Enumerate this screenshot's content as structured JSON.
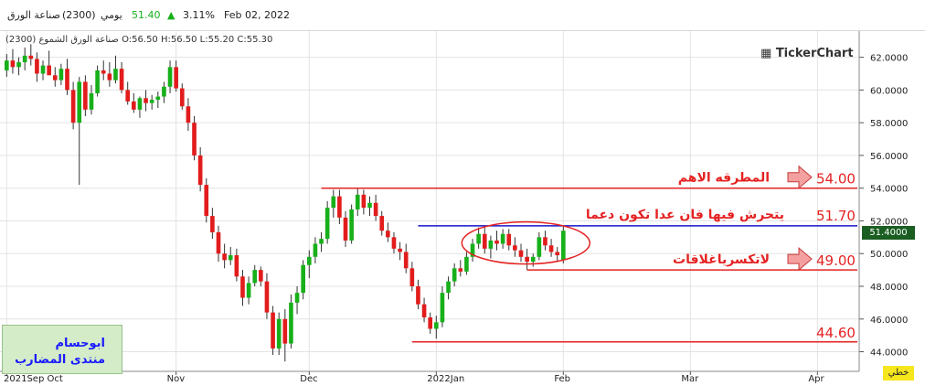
{
  "header": {
    "date": "Feb 02, 2022",
    "change_pct": "3.11%",
    "up_arrow": "▲",
    "price": "51.40",
    "period": "يومي",
    "symbol": "(2300)",
    "name": "صناعة الورق"
  },
  "subtitle": "صناعة الورق الشموع (2300) O:56.50 H:56.50 L:55.20 C:55.30",
  "logo": "TickerChart",
  "price_tag": "51.4000",
  "chart_mode": "خطي",
  "watermark": {
    "line1": "ابوحسام",
    "line2": "منتدى المضارب"
  },
  "colors": {
    "up": "#17b01a",
    "down": "#e21c1c",
    "level": "#e52222",
    "resistance_blue": "#1616c8",
    "grid": "#e3e3e3"
  },
  "chart_data": {
    "type": "candlestick",
    "ylim": [
      42.8,
      63.6
    ],
    "y_ticks": [
      {
        "value": 44,
        "label": "44.0000"
      },
      {
        "value": 46,
        "label": "46.0000"
      },
      {
        "value": 48,
        "label": "48.0000"
      },
      {
        "value": 50,
        "label": "50.0000"
      },
      {
        "value": 52,
        "label": "52.0000"
      },
      {
        "value": 54,
        "label": "54.0000"
      },
      {
        "value": 56,
        "label": "56.0000"
      },
      {
        "value": 58,
        "label": "58.0000"
      },
      {
        "value": 60,
        "label": "60.0000"
      },
      {
        "value": 62,
        "label": "62.0000"
      }
    ],
    "x_ticks": [
      {
        "index": 0,
        "label": "2021Sep Oct"
      },
      {
        "index": 28,
        "label": "Nov"
      },
      {
        "index": 50,
        "label": "Dec"
      },
      {
        "index": 71,
        "label": "2022Jan"
      },
      {
        "index": 92,
        "label": "Feb"
      },
      {
        "index": 113,
        "label": "Mar"
      },
      {
        "index": 134,
        "label": "Apr"
      }
    ],
    "x_slots": 142,
    "candles": [
      [
        61.2,
        62.2,
        60.8,
        61.8
      ],
      [
        61.8,
        62.5,
        61.0,
        61.4
      ],
      [
        61.4,
        62.0,
        60.9,
        61.7
      ],
      [
        61.7,
        62.6,
        61.2,
        62.1
      ],
      [
        62.1,
        62.8,
        61.5,
        61.9
      ],
      [
        61.9,
        62.3,
        60.5,
        61.0
      ],
      [
        61.0,
        61.8,
        60.6,
        61.5
      ],
      [
        61.5,
        62.4,
        61.0,
        60.9
      ],
      [
        60.9,
        61.4,
        60.2,
        60.6
      ],
      [
        60.6,
        61.6,
        60.3,
        61.3
      ],
      [
        61.3,
        61.9,
        59.7,
        60.0
      ],
      [
        60.0,
        60.5,
        57.6,
        58.0
      ],
      [
        58.0,
        60.8,
        54.2,
        60.5
      ],
      [
        60.5,
        60.9,
        58.4,
        58.8
      ],
      [
        58.8,
        60.3,
        58.5,
        59.8
      ],
      [
        59.8,
        61.5,
        59.6,
        61.2
      ],
      [
        61.2,
        61.8,
        60.6,
        61.0
      ],
      [
        61.0,
        61.7,
        60.2,
        60.6
      ],
      [
        60.6,
        62.1,
        60.4,
        61.3
      ],
      [
        61.3,
        61.7,
        59.8,
        60.0
      ],
      [
        60.0,
        60.5,
        59.1,
        59.3
      ],
      [
        59.3,
        59.8,
        58.6,
        58.8
      ],
      [
        58.8,
        59.6,
        58.3,
        59.5
      ],
      [
        59.5,
        60.0,
        58.7,
        59.2
      ],
      [
        59.2,
        59.7,
        58.8,
        59.4
      ],
      [
        59.4,
        59.9,
        58.9,
        59.6
      ],
      [
        59.6,
        60.5,
        59.2,
        60.2
      ],
      [
        60.2,
        61.8,
        59.8,
        61.4
      ],
      [
        61.4,
        61.8,
        59.9,
        60.1
      ],
      [
        60.1,
        60.4,
        58.8,
        59.0
      ],
      [
        59.0,
        59.5,
        57.5,
        58.0
      ],
      [
        58.0,
        58.4,
        55.7,
        56.0
      ],
      [
        56.0,
        56.5,
        53.8,
        54.2
      ],
      [
        54.2,
        54.6,
        51.9,
        52.3
      ],
      [
        52.3,
        52.8,
        50.9,
        51.3
      ],
      [
        51.3,
        51.7,
        49.5,
        50.0
      ],
      [
        50.0,
        50.6,
        49.1,
        49.6
      ],
      [
        49.6,
        50.4,
        49.3,
        49.9
      ],
      [
        49.9,
        50.3,
        48.3,
        48.6
      ],
      [
        48.6,
        49.0,
        46.8,
        47.3
      ],
      [
        47.3,
        48.6,
        46.9,
        48.2
      ],
      [
        48.2,
        49.3,
        48.0,
        49.0
      ],
      [
        49.0,
        49.2,
        48.0,
        48.3
      ],
      [
        48.3,
        48.8,
        46.0,
        46.4
      ],
      [
        46.4,
        46.8,
        43.8,
        44.2
      ],
      [
        44.2,
        46.4,
        43.8,
        46.0
      ],
      [
        46.0,
        46.6,
        43.4,
        44.5
      ],
      [
        44.5,
        47.5,
        44.2,
        47.0
      ],
      [
        47.0,
        48.0,
        46.3,
        47.6
      ],
      [
        47.6,
        49.6,
        47.2,
        49.3
      ],
      [
        49.3,
        50.2,
        48.5,
        49.8
      ],
      [
        49.8,
        51.0,
        49.4,
        50.6
      ],
      [
        50.6,
        51.3,
        50.1,
        50.9
      ],
      [
        50.9,
        53.2,
        50.6,
        52.8
      ],
      [
        52.8,
        53.9,
        52.2,
        53.5
      ],
      [
        53.5,
        53.9,
        51.8,
        52.2
      ],
      [
        52.2,
        52.6,
        50.4,
        50.8
      ],
      [
        50.8,
        53.0,
        50.6,
        52.7
      ],
      [
        52.7,
        54.0,
        52.3,
        53.6
      ],
      [
        53.6,
        53.9,
        52.4,
        52.8
      ],
      [
        52.8,
        53.5,
        52.3,
        53.1
      ],
      [
        53.1,
        53.6,
        52.0,
        52.3
      ],
      [
        52.3,
        52.6,
        51.1,
        51.4
      ],
      [
        51.4,
        51.9,
        50.7,
        51.0
      ],
      [
        51.0,
        51.3,
        50.0,
        50.3
      ],
      [
        50.3,
        50.7,
        49.6,
        50.1
      ],
      [
        50.1,
        50.6,
        48.8,
        49.1
      ],
      [
        49.1,
        49.5,
        47.7,
        48.0
      ],
      [
        48.0,
        48.4,
        46.6,
        46.9
      ],
      [
        46.9,
        47.3,
        45.8,
        46.1
      ],
      [
        46.1,
        46.4,
        45.1,
        45.4
      ],
      [
        45.4,
        46.2,
        44.8,
        45.8
      ],
      [
        45.8,
        48.0,
        45.5,
        47.6
      ],
      [
        47.6,
        48.6,
        47.2,
        48.3
      ],
      [
        48.3,
        49.4,
        48.0,
        49.1
      ],
      [
        49.1,
        49.6,
        48.6,
        48.9
      ],
      [
        48.9,
        50.1,
        48.7,
        49.8
      ],
      [
        49.8,
        50.9,
        49.5,
        50.6
      ],
      [
        50.6,
        51.6,
        50.3,
        51.2
      ],
      [
        51.2,
        51.6,
        50.0,
        50.3
      ],
      [
        50.3,
        51.1,
        49.7,
        50.8
      ],
      [
        50.8,
        51.4,
        50.2,
        50.6
      ],
      [
        50.6,
        51.5,
        50.3,
        51.2
      ],
      [
        51.2,
        51.5,
        50.2,
        50.5
      ],
      [
        50.5,
        51.0,
        49.8,
        50.2
      ],
      [
        50.2,
        50.6,
        49.5,
        49.8
      ],
      [
        49.8,
        50.3,
        49.0,
        49.5
      ],
      [
        49.5,
        50.0,
        49.2,
        49.8
      ],
      [
        49.8,
        51.3,
        49.6,
        51.0
      ],
      [
        51.0,
        51.4,
        50.2,
        50.5
      ],
      [
        50.5,
        50.9,
        49.8,
        50.1
      ],
      [
        50.1,
        50.4,
        49.5,
        49.9
      ],
      [
        49.6,
        51.7,
        49.4,
        51.4
      ]
    ],
    "levels": [
      {
        "value": 54.0,
        "label": "54.00",
        "start_index": 52,
        "note": "المطرقه الاهم"
      },
      {
        "value": 49.0,
        "label": "49.00",
        "start_index": 86,
        "note": "لاتكسرياغلاقات"
      },
      {
        "value": 44.6,
        "label": "44.60",
        "start_index": 67,
        "note": ""
      }
    ],
    "resistance": {
      "value": 51.7,
      "label": "51.70",
      "start_index": 68,
      "note": "يتحرش فيها فان عدا تكون دعما"
    },
    "grid": true
  }
}
